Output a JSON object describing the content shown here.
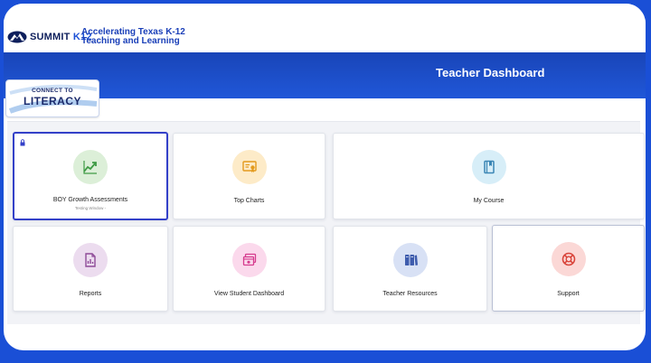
{
  "brand": {
    "logo_word": "SUMMIT",
    "logo_k12": "K12",
    "tagline_line1": "Accelerating Texas K-12",
    "tagline_line2": "Teaching and Learning"
  },
  "header": {
    "title": "Teacher Dashboard"
  },
  "badge": {
    "top_text": "CONNECT TO",
    "main_text": "LITERACY"
  },
  "cards": [
    {
      "label": "BOY Growth Assessments",
      "sublabel": "Testing Window -",
      "icon": "chart-line-icon",
      "color": "#dcefd8",
      "iconColor": "#3f9b45"
    },
    {
      "label": "Top Charts",
      "sublabel": "",
      "icon": "certificate-icon",
      "color": "#fdebc8",
      "iconColor": "#e39a1c"
    },
    {
      "label": "My Course",
      "sublabel": "",
      "icon": "book-icon",
      "color": "#d7eef8",
      "iconColor": "#3b86b5"
    },
    {
      "label": "Reports",
      "sublabel": "",
      "icon": "report-icon",
      "color": "#ecdcef",
      "iconColor": "#8e4a98"
    },
    {
      "label": "View Student Dashboard",
      "sublabel": "",
      "icon": "dashboard-icon",
      "color": "#fbd9ec",
      "iconColor": "#d63c8e"
    },
    {
      "label": "Teacher Resources",
      "sublabel": "",
      "icon": "binders-icon",
      "color": "#d8e1f5",
      "iconColor": "#3e5cad"
    },
    {
      "label": "Support",
      "sublabel": "",
      "icon": "lifebuoy-icon",
      "color": "#fbd8d6",
      "iconColor": "#d9443a"
    }
  ]
}
